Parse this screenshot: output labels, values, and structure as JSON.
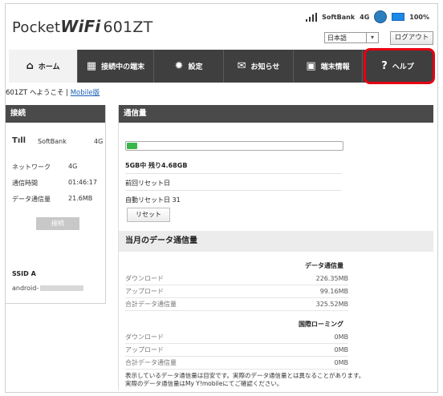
{
  "header": {
    "logo_pocket": "Pocket",
    "logo_wifi": "WiFi",
    "logo_model": "601ZT",
    "carrier": "SoftBank",
    "network": "4G",
    "battery": "100%",
    "language": "日本語",
    "logout": "ログアウト"
  },
  "nav": {
    "items": [
      {
        "label": "ホーム",
        "icon": "home-icon"
      },
      {
        "label": "接続中の端末",
        "icon": "devices-icon"
      },
      {
        "label": "設定",
        "icon": "gear-icon"
      },
      {
        "label": "お知らせ",
        "icon": "mail-icon"
      },
      {
        "label": "端末情報",
        "icon": "device-info-icon"
      },
      {
        "label": "ヘルプ",
        "icon": "question-icon"
      }
    ],
    "highlight_color": "#e60012"
  },
  "welcome": {
    "text": "601ZT へようこそ | ",
    "mobile_link": "Mobile版"
  },
  "connection": {
    "title": "接続",
    "carrier": "SoftBank",
    "network": "4G",
    "rows": [
      {
        "label": "ネットワーク",
        "value": "4G"
      },
      {
        "label": "通信時間",
        "value": "01:46:17"
      },
      {
        "label": "データ通信量",
        "value": "21.6MB"
      }
    ],
    "connect_button": "接続",
    "ssid_label": "SSID A",
    "ssid_value": "android-"
  },
  "usage": {
    "title": "通信量",
    "used_fraction": 0.05,
    "summary": "5GB中  残り4.68GB",
    "last_reset": "前回リセット日",
    "auto_reset": "自動リセット日  31",
    "reset_button": "リセット",
    "fill_color": "#3ab54a"
  },
  "monthly": {
    "title": "当月のデータ通信量",
    "data_header": "データ通信量",
    "data_rows": [
      {
        "label": "ダウンロード",
        "value": "226.35MB"
      },
      {
        "label": "アップロード",
        "value": "99.16MB"
      },
      {
        "label": "合計データ通信量",
        "value": "325.52MB"
      }
    ],
    "roaming_header": "国際ローミング",
    "roaming_rows": [
      {
        "label": "ダウンロード",
        "value": "0MB"
      },
      {
        "label": "アップロード",
        "value": "0MB"
      },
      {
        "label": "合計データ通信量",
        "value": "0MB"
      }
    ],
    "note_line1": "表示しているデータ通信量は目安です。実際のデータ通信量とは異なることがあります。",
    "note_line2": "実際のデータ通信量はMy Y!mobileにてご確認ください。"
  }
}
